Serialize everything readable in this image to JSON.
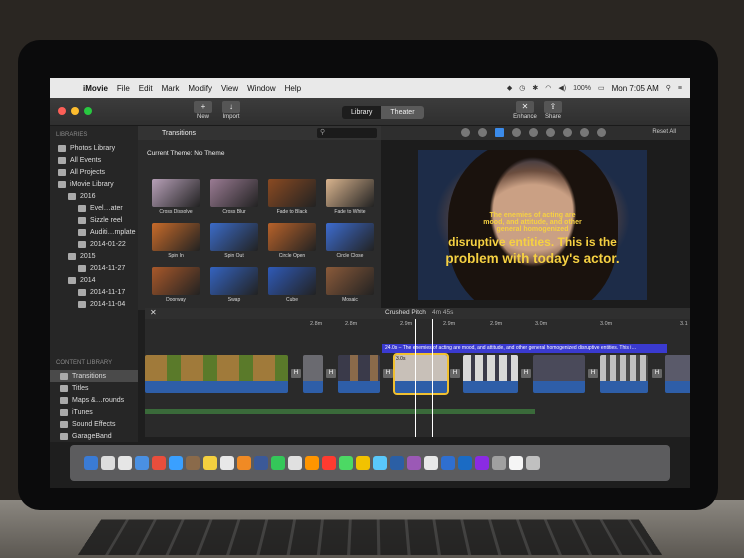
{
  "menubar": {
    "app_name": "iMovie",
    "items": [
      "File",
      "Edit",
      "Mark",
      "Modify",
      "View",
      "Window",
      "Help"
    ],
    "battery": "100%",
    "clock": "Mon 7:05 AM"
  },
  "toolbar": {
    "new_label": "New",
    "import_label": "Import",
    "library_tab": "Library",
    "theater_tab": "Theater",
    "enhance_label": "Enhance",
    "share_label": "Share"
  },
  "sidebar": {
    "libraries_header": "LIBRARIES",
    "items": [
      {
        "label": "Photos Library",
        "indent": 0
      },
      {
        "label": "All Events",
        "indent": 0
      },
      {
        "label": "All Projects",
        "indent": 0
      },
      {
        "label": "iMovie Library",
        "indent": 0
      },
      {
        "label": "2016",
        "indent": 1
      },
      {
        "label": "Evel…ater",
        "indent": 2
      },
      {
        "label": "Sizzle reel",
        "indent": 2
      },
      {
        "label": "Auditi…mplate",
        "indent": 2
      },
      {
        "label": "2014-01-22",
        "indent": 2
      },
      {
        "label": "2015",
        "indent": 1
      },
      {
        "label": "2014-11-27",
        "indent": 2
      },
      {
        "label": "2014",
        "indent": 1
      },
      {
        "label": "2014-11-17",
        "indent": 2
      },
      {
        "label": "2014-11-04",
        "indent": 2
      }
    ],
    "content_header": "CONTENT LIBRARY",
    "content_items": [
      "Transitions",
      "Titles",
      "Maps &…rounds",
      "iTunes",
      "Sound Effects",
      "GarageBand"
    ]
  },
  "browser": {
    "title": "Transitions",
    "theme": "Current Theme: No Theme",
    "transitions": [
      {
        "label": "Cross Dissolve",
        "color": "#b7a0b8"
      },
      {
        "label": "Cross Blur",
        "color": "#9a7b93"
      },
      {
        "label": "Fade to Black",
        "color": "#8a4a22"
      },
      {
        "label": "Fade to White",
        "color": "#d9b48e"
      },
      {
        "label": "Spin In",
        "color": "#c86b2a"
      },
      {
        "label": "Spin Out",
        "color": "#3b6bc8"
      },
      {
        "label": "Circle Open",
        "color": "#b8622a"
      },
      {
        "label": "Circle Close",
        "color": "#3d6cd0"
      },
      {
        "label": "Doorway",
        "color": "#a8582a"
      },
      {
        "label": "Swap",
        "color": "#3463c0"
      },
      {
        "label": "Cube",
        "color": "#2f5ab8"
      },
      {
        "label": "Mosaic",
        "color": "#8a5a3a"
      }
    ]
  },
  "viewer": {
    "reset_label": "Reset All",
    "subtitle_line1": "The enemies of acting are",
    "subtitle_line2": "mood, and attitude, and other",
    "subtitle_line3": "general homogenized",
    "subtitle_line4": "disruptive entities. This is the",
    "subtitle_line5": "problem with today's actor."
  },
  "timeline": {
    "project_name": "Crushed Pitch",
    "duration": "4m 45s",
    "ruler_marks": [
      "2.8m",
      "2.8m",
      "2.9m",
      "2.9m",
      "2.9m",
      "3.0m",
      "3.0m",
      "3.1"
    ],
    "caption": "24.0s – The enemies of acting are mood, and attitude, and other general homogenized disruptive entities. This i…",
    "selected_clip_label": "3.0s",
    "transition_marker": "H"
  },
  "colors": {
    "accent_blue": "#3b8bea",
    "caption_blue": "#3a3ad0",
    "subtitle_yellow": "#f6d142"
  }
}
